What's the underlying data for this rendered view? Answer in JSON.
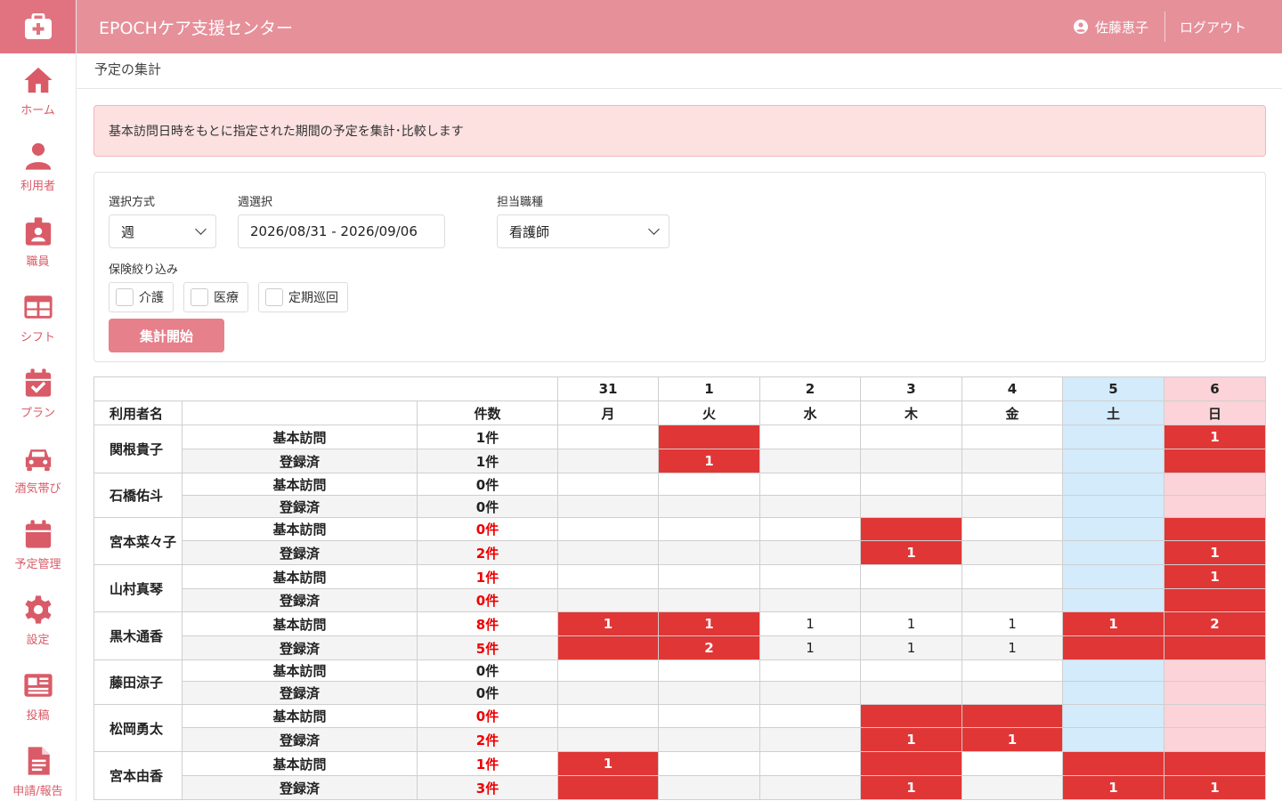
{
  "app": {
    "title": "EPOCHケア支援センター",
    "user_name": "佐藤恵子",
    "logout": "ログアウト"
  },
  "sidebar": {
    "items": [
      {
        "label": "ホーム",
        "icon": "home-icon"
      },
      {
        "label": "利用者",
        "icon": "person-icon"
      },
      {
        "label": "職員",
        "icon": "staff-badge-icon"
      },
      {
        "label": "シフト",
        "icon": "table-icon"
      },
      {
        "label": "プラン",
        "icon": "calendar-check-icon"
      },
      {
        "label": "酒気帯び",
        "icon": "car-icon"
      },
      {
        "label": "予定管理",
        "icon": "calendar-icon"
      },
      {
        "label": "設定",
        "icon": "gear-icon"
      },
      {
        "label": "投稿",
        "icon": "newspaper-icon"
      },
      {
        "label": "申請/報告",
        "icon": "document-icon"
      }
    ]
  },
  "page": {
    "breadcrumb": "予定の集計",
    "notice": "基本訪問日時をもとに指定された期間の予定を集計･比較します"
  },
  "filter": {
    "method_label": "選択方式",
    "method_value": "週",
    "week_label": "週選択",
    "week_value": "2026/08/31 - 2026/09/06",
    "role_label": "担当職種",
    "role_value": "看護師",
    "insurance_label": "保険絞り込み",
    "checks": [
      "介護",
      "医療",
      "定期巡回"
    ],
    "run_label": "集計開始"
  },
  "table": {
    "name_header": "利用者名",
    "count_header": "件数",
    "dates": [
      "31",
      "1",
      "2",
      "3",
      "4",
      "5",
      "6"
    ],
    "weekdays": [
      "月",
      "火",
      "水",
      "木",
      "金",
      "土",
      "日"
    ],
    "row_kinds": [
      "基本訪問",
      "登録済"
    ],
    "rows": [
      {
        "name": "関根貴子",
        "a_count": "1件",
        "b_count": "1件",
        "a_warn": false,
        "b_warn": false,
        "a_cells": [
          "",
          "",
          "",
          "",
          "",
          "",
          "1"
        ],
        "b_cells": [
          "",
          "1",
          "",
          "",
          "",
          "",
          ""
        ],
        "a_hl": [
          0,
          1,
          0,
          0,
          0,
          0,
          1
        ],
        "b_hl": [
          0,
          1,
          0,
          0,
          0,
          0,
          1
        ]
      },
      {
        "name": "石橋佑斗",
        "a_count": "0件",
        "b_count": "0件",
        "a_warn": false,
        "b_warn": false,
        "a_cells": [
          "",
          "",
          "",
          "",
          "",
          "",
          ""
        ],
        "b_cells": [
          "",
          "",
          "",
          "",
          "",
          "",
          ""
        ],
        "a_hl": [
          0,
          0,
          0,
          0,
          0,
          0,
          0
        ],
        "b_hl": [
          0,
          0,
          0,
          0,
          0,
          0,
          0
        ]
      },
      {
        "name": "宮本菜々子",
        "a_count": "0件",
        "b_count": "2件",
        "a_warn": true,
        "b_warn": true,
        "a_cells": [
          "",
          "",
          "",
          "",
          "",
          "",
          ""
        ],
        "b_cells": [
          "",
          "",
          "",
          "1",
          "",
          "",
          "1"
        ],
        "a_hl": [
          0,
          0,
          0,
          1,
          0,
          0,
          1
        ],
        "b_hl": [
          0,
          0,
          0,
          1,
          0,
          0,
          1
        ]
      },
      {
        "name": "山村真琴",
        "a_count": "1件",
        "b_count": "0件",
        "a_warn": true,
        "b_warn": true,
        "a_cells": [
          "",
          "",
          "",
          "",
          "",
          "",
          "1"
        ],
        "b_cells": [
          "",
          "",
          "",
          "",
          "",
          "",
          ""
        ],
        "a_hl": [
          0,
          0,
          0,
          0,
          0,
          0,
          1
        ],
        "b_hl": [
          0,
          0,
          0,
          0,
          0,
          0,
          1
        ]
      },
      {
        "name": "黒木通香",
        "a_count": "8件",
        "b_count": "5件",
        "a_warn": true,
        "b_warn": true,
        "a_cells": [
          "1",
          "1",
          "1",
          "1",
          "1",
          "1",
          "2"
        ],
        "b_cells": [
          "",
          "2",
          "1",
          "1",
          "1",
          "",
          ""
        ],
        "a_hl": [
          1,
          1,
          0,
          0,
          0,
          1,
          1
        ],
        "b_hl": [
          1,
          1,
          0,
          0,
          0,
          1,
          1
        ]
      },
      {
        "name": "藤田涼子",
        "a_count": "0件",
        "b_count": "0件",
        "a_warn": false,
        "b_warn": false,
        "a_cells": [
          "",
          "",
          "",
          "",
          "",
          "",
          ""
        ],
        "b_cells": [
          "",
          "",
          "",
          "",
          "",
          "",
          ""
        ],
        "a_hl": [
          0,
          0,
          0,
          0,
          0,
          0,
          0
        ],
        "b_hl": [
          0,
          0,
          0,
          0,
          0,
          0,
          0
        ]
      },
      {
        "name": "松岡勇太",
        "a_count": "0件",
        "b_count": "2件",
        "a_warn": true,
        "b_warn": true,
        "a_cells": [
          "",
          "",
          "",
          "",
          "",
          "",
          ""
        ],
        "b_cells": [
          "",
          "",
          "",
          "1",
          "1",
          "",
          ""
        ],
        "a_hl": [
          0,
          0,
          0,
          1,
          1,
          0,
          0
        ],
        "b_hl": [
          0,
          0,
          0,
          1,
          1,
          0,
          0
        ]
      },
      {
        "name": "宮本由香",
        "a_count": "1件",
        "b_count": "3件",
        "a_warn": true,
        "b_warn": true,
        "a_cells": [
          "1",
          "",
          "",
          "",
          "",
          "",
          ""
        ],
        "b_cells": [
          "",
          "",
          "",
          "1",
          "",
          "1",
          "1"
        ],
        "a_hl": [
          1,
          0,
          0,
          1,
          0,
          1,
          1
        ],
        "b_hl": [
          1,
          0,
          0,
          1,
          0,
          1,
          1
        ]
      }
    ]
  },
  "colors": {
    "brand": "#e6909a",
    "sidebar_icon": "#d95b68",
    "highlight": "#e13636",
    "saturday": "#d3ebfb",
    "sunday": "#fbd3d8",
    "warn_text": "#e00000"
  }
}
